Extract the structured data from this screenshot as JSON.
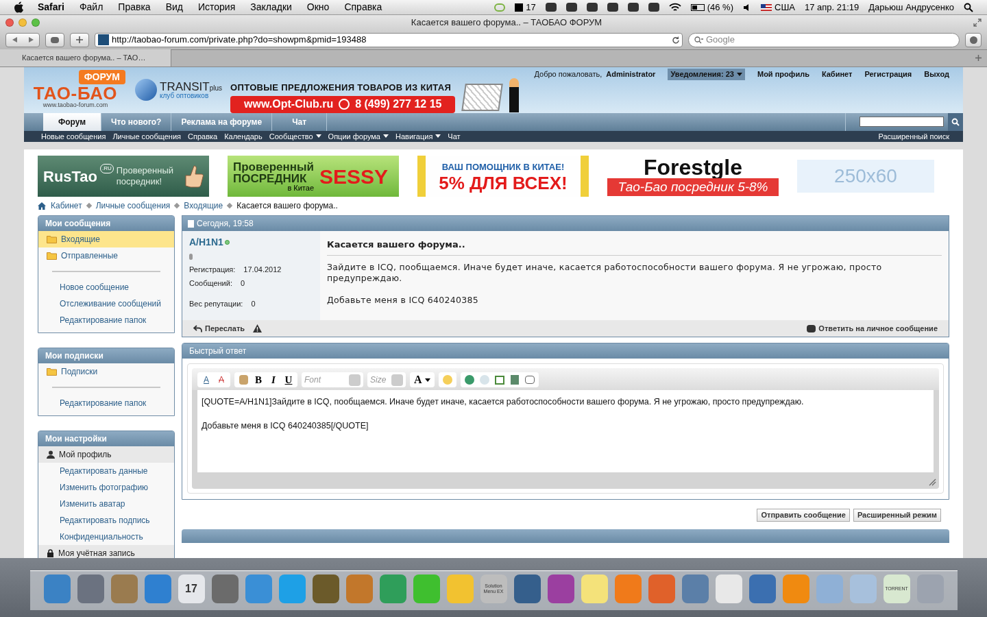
{
  "menubar": {
    "app": "Safari",
    "menus": [
      "Файл",
      "Правка",
      "Вид",
      "История",
      "Закладки",
      "Окно",
      "Справка"
    ],
    "status": [
      {
        "kind": "leaf"
      },
      {
        "kind": "adobe",
        "text": "17"
      },
      {
        "kind": "icon"
      },
      {
        "kind": "icon"
      },
      {
        "kind": "icon"
      },
      {
        "kind": "icon"
      },
      {
        "kind": "icon"
      },
      {
        "kind": "icon"
      },
      {
        "kind": "wifi"
      },
      {
        "kind": "battery",
        "text": "(46 %)"
      },
      {
        "kind": "volume"
      },
      {
        "kind": "flag",
        "text": "США"
      },
      {
        "kind": "text",
        "text": "17 апр.  21:19"
      },
      {
        "kind": "text",
        "text": "Дарьюш Андрусенко"
      },
      {
        "kind": "search"
      }
    ]
  },
  "window": {
    "title": "Касается вашего форума.. – ТАОБАО ФОРУМ",
    "url": "http://taobao-forum.com/private.php?do=showpm&pmid=193488",
    "search_placeholder": "Google",
    "tab": "Касается вашего форума.. – TAO…"
  },
  "header": {
    "logo_badge": "ФОРУМ",
    "logo": "ТАО-БАО",
    "logo_url": "www.taobao-forum.com",
    "transit": "TRANSIT",
    "transit_plus": "plus",
    "transit_sub": "клуб оптовиков",
    "promo_title": "ОПТОВЫЕ ПРЕДЛОЖЕНИЯ ТОВАРОВ ИЗ КИТАЯ",
    "promo_site": "www.Opt-Club.ru",
    "promo_phone": "8 (499) 277 12 15",
    "welcome": "Добро пожаловать,",
    "user": "Administrator",
    "notifications": "Уведомления: 23",
    "links": [
      "Мой профиль",
      "Кабинет",
      "Регистрация",
      "Выход"
    ]
  },
  "nav_tabs": [
    {
      "label": "Форум",
      "selected": true
    },
    {
      "label": "Что нового?",
      "selected": false
    },
    {
      "label": "Реклама на форуме",
      "selected": false
    },
    {
      "label": "Чат",
      "selected": false
    }
  ],
  "subnav": [
    {
      "label": "Новые сообщения",
      "dropdown": false
    },
    {
      "label": "Личные сообщения",
      "dropdown": false
    },
    {
      "label": "Справка",
      "dropdown": false
    },
    {
      "label": "Календарь",
      "dropdown": false
    },
    {
      "label": "Сообщество",
      "dropdown": true
    },
    {
      "label": "Опции форума",
      "dropdown": true
    },
    {
      "label": "Навигация",
      "dropdown": true
    },
    {
      "label": "Чат",
      "dropdown": false
    }
  ],
  "advanced_search": "Расширенный поиск",
  "banners": [
    {
      "kind": "rustao",
      "texts": [
        "RusTao",
        ".RU",
        "Проверенный посредник!"
      ]
    },
    {
      "kind": "sessy",
      "texts": [
        "Проверенный",
        "ПОСРЕДНИК",
        "SESSY",
        "в Китае"
      ]
    },
    {
      "kind": "helper",
      "texts": [
        "ВАШ ПОМОЩНИК В КИТАЕ!",
        "5% ДЛЯ ВСЕХ!"
      ]
    },
    {
      "kind": "forestgle",
      "texts": [
        "Forestgle",
        "Тао-Бао посредник 5-8%"
      ]
    },
    {
      "kind": "empty",
      "texts": [
        "250x60"
      ]
    }
  ],
  "breadcrumb": [
    "Кабинет",
    "Личные сообщения",
    "Входящие",
    "Касается вашего форума.."
  ],
  "sidebar": [
    {
      "title": "Мои сообщения",
      "items": [
        {
          "kind": "folder",
          "label": "Входящие",
          "selected": true
        },
        {
          "kind": "folder",
          "label": "Отправленные",
          "selected": false
        },
        {
          "kind": "divider"
        },
        {
          "kind": "link",
          "label": "Новое сообщение",
          "selected": false
        },
        {
          "kind": "link",
          "label": "Отслеживание сообщений",
          "selected": false
        },
        {
          "kind": "link",
          "label": "Редактирование папок",
          "selected": false
        }
      ]
    },
    {
      "title": "Мои подписки",
      "items": [
        {
          "kind": "folder",
          "label": "Подписки",
          "selected": false
        },
        {
          "kind": "divider"
        },
        {
          "kind": "link",
          "label": "Редактирование папок",
          "selected": false
        }
      ]
    },
    {
      "title": "Мои настройки",
      "items": [
        {
          "kind": "profile",
          "label": "Мой профиль"
        },
        {
          "kind": "link",
          "label": "Редактировать данные",
          "selected": false
        },
        {
          "kind": "link",
          "label": "Изменить фотографию",
          "selected": false
        },
        {
          "kind": "link",
          "label": "Изменить аватар",
          "selected": false
        },
        {
          "kind": "link",
          "label": "Редактировать подпись",
          "selected": false
        },
        {
          "kind": "link",
          "label": "Конфиденциальность",
          "selected": false
        },
        {
          "kind": "account",
          "label": "Моя учётная запись"
        }
      ]
    }
  ],
  "post": {
    "date": "Сегодня, 19:58",
    "username": "A/H1N1",
    "online": true,
    "fields": [
      {
        "label": "Регистрация:",
        "value": "17.04.2012"
      },
      {
        "label": "Сообщений:",
        "value": "0"
      },
      {
        "label": "Вес репутации:",
        "value": "0"
      }
    ],
    "title": "Касается вашего форума..",
    "body": [
      "Зайдите в ICQ, пообщаемся. Иначе будет иначе, касается работоспособности вашего форума. Я не угрожаю, просто предупреждаю.",
      "Добавьте меня в ICQ 640240385"
    ],
    "forward": "Переслать",
    "reply": "Ответить на личное сообщение"
  },
  "quick_reply": {
    "title": "Быстрый ответ",
    "format_buttons": [
      {
        "kind": "remove",
        "text": "A"
      },
      {
        "kind": "clear",
        "text": "A"
      },
      {
        "kind": "bold",
        "text": "B"
      },
      {
        "kind": "italic",
        "text": "I"
      },
      {
        "kind": "underline",
        "text": "U"
      }
    ],
    "color_button": "A",
    "font": "Font",
    "size": "Size",
    "text": [
      "[QUOTE=A/H1N1]Зайдите в ICQ, пообщаемся. Иначе будет иначе, касается работоспособности вашего форума. Я не угрожаю, просто предупреждаю.",
      "Добавьте меня в ICQ 640240385[/QUOTE]"
    ],
    "buttons": [
      "Отправить сообщение",
      "Расширенный режим"
    ]
  },
  "dock": [
    {
      "color": "#3b82c4"
    },
    {
      "color": "#6b7280"
    },
    {
      "color": "#9a7b4f"
    },
    {
      "color": "#2f80d0"
    },
    {
      "color": "#e5e7eb",
      "text": "17"
    },
    {
      "color": "#6b6b6b"
    },
    {
      "color": "#3a8fd6"
    },
    {
      "color": "#1ea0e6"
    },
    {
      "color": "#6b5a2a"
    },
    {
      "color": "#c2772b"
    },
    {
      "color": "#2f9e5a"
    },
    {
      "color": "#3fbf2f"
    },
    {
      "color": "#f2c230"
    },
    {
      "color": "#bdbdbd",
      "text": "Solution Menu EX"
    },
    {
      "color": "#355f8c"
    },
    {
      "color": "#9b3fa0"
    },
    {
      "color": "#f4e27a"
    },
    {
      "color": "#f07a1a"
    },
    {
      "color": "#e0612a"
    },
    {
      "color": "#5b7fa8"
    },
    {
      "color": "#e8e8e8"
    },
    {
      "color": "#3b6fb0"
    },
    {
      "color": "#f08a10"
    },
    {
      "color": "#8fb0d6"
    },
    {
      "color": "#a7c0dc"
    },
    {
      "color": "#d8e8d0",
      "text": "TORRENT"
    },
    {
      "color": "#9ca3af"
    }
  ]
}
